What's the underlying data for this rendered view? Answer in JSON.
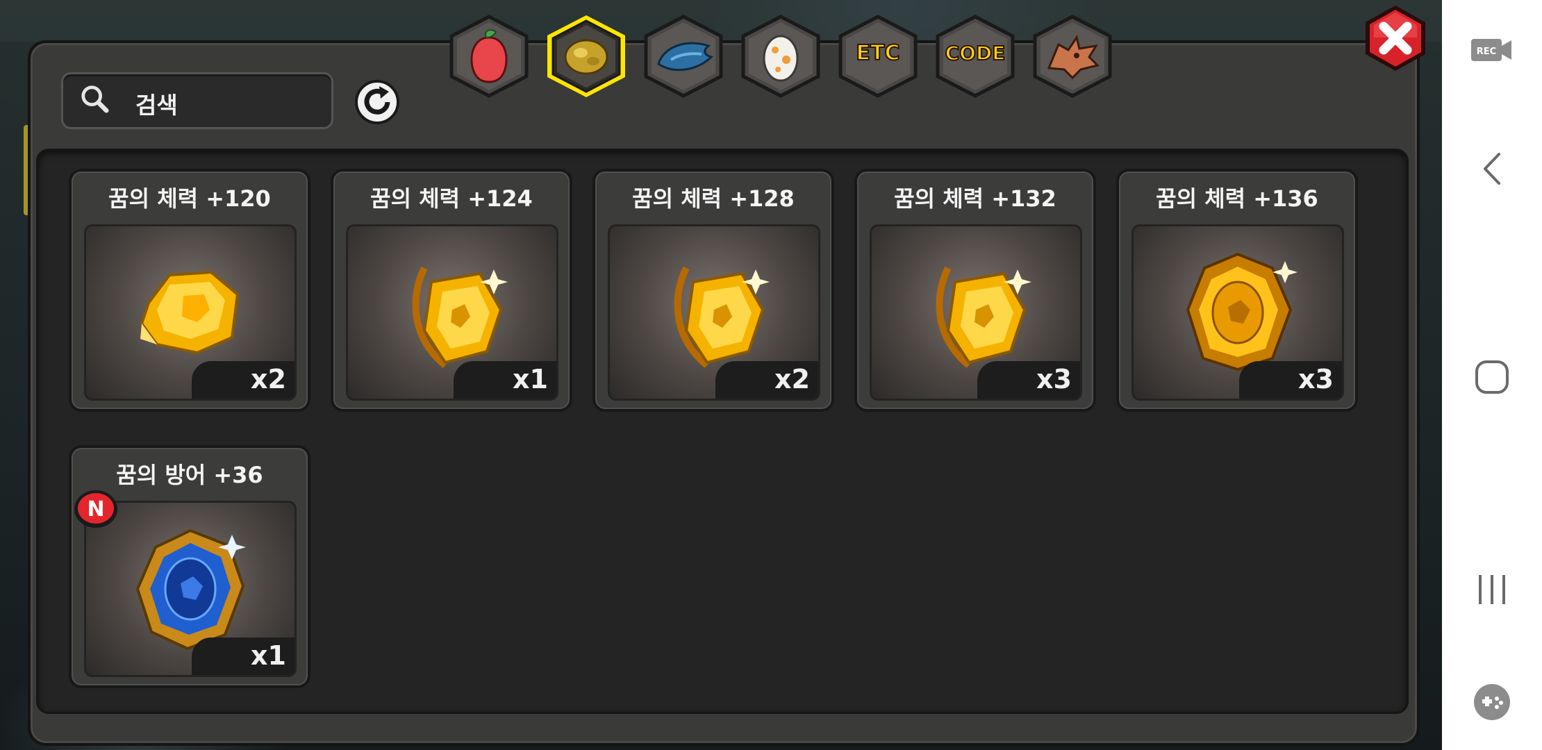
{
  "search": {
    "placeholder": "검색"
  },
  "tabs": [
    {
      "name": "fruit",
      "label": "",
      "selected": false
    },
    {
      "name": "gem",
      "label": "",
      "selected": true
    },
    {
      "name": "dragon-egg-blue",
      "label": "",
      "selected": false
    },
    {
      "name": "egg",
      "label": "",
      "selected": false
    },
    {
      "name": "etc",
      "label": "ETC",
      "selected": false
    },
    {
      "name": "code",
      "label": "CODE",
      "selected": false
    },
    {
      "name": "dragon",
      "label": "",
      "selected": false
    }
  ],
  "items": [
    {
      "title": "꿈의 체력 +120",
      "qty": "x2",
      "gem": "gold-raw-gem-icon",
      "is_new": false
    },
    {
      "title": "꿈의 체력 +124",
      "qty": "x1",
      "gem": "gold-dragon-gem-icon",
      "is_new": false
    },
    {
      "title": "꿈의 체력 +128",
      "qty": "x2",
      "gem": "gold-dragon-gem-icon",
      "is_new": false
    },
    {
      "title": "꿈의 체력 +132",
      "qty": "x3",
      "gem": "gold-dragon-gem-icon",
      "is_new": false
    },
    {
      "title": "꿈의 체력 +136",
      "qty": "x3",
      "gem": "gold-framed-gem-icon",
      "is_new": false
    },
    {
      "title": "꿈의 방어 +36",
      "qty": "x1",
      "gem": "blue-framed-gem-icon",
      "is_new": true
    }
  ],
  "new_badge": {
    "label": "N"
  },
  "navbar": {
    "rec_label": "REC",
    "icons": [
      "record-icon",
      "back-icon",
      "home-icon",
      "recents-icon",
      "game-tools-icon"
    ]
  },
  "colors": {
    "accent": "#ffd21a",
    "close": "#d8222a",
    "panel": "#3a3a38"
  }
}
